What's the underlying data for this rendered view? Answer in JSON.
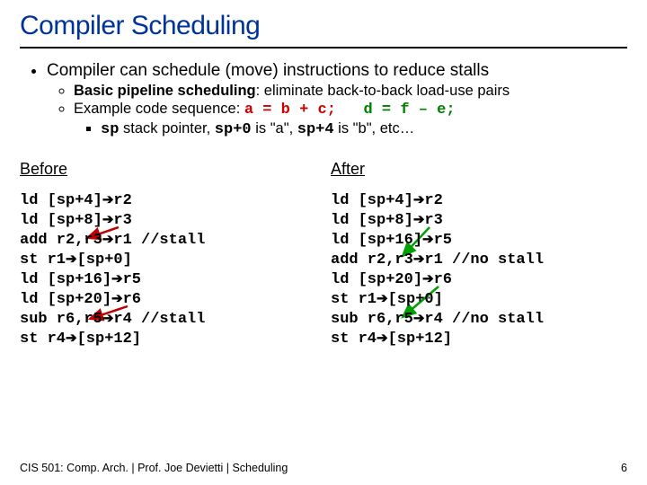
{
  "title": "Compiler Scheduling",
  "b1": "Compiler can schedule (move) instructions to reduce stalls",
  "s1a": "Basic pipeline scheduling",
  "s1b": ": eliminate back-to-back load-use pairs",
  "s2a": "Example code sequence: ",
  "s2c1": "a = b + c;",
  "s2gap": "   ",
  "s2c2": "d = f – e;",
  "ss_a": " stack pointer, ",
  "ss_sp": "sp",
  "ss_b": " is \"a\", ",
  "ss_sp0": "sp+0",
  "ss_c": " is \"b\", etc…",
  "ss_sp4": "sp+4",
  "before": "Before",
  "after": "After",
  "bc": {
    "l1a": "ld [sp+4]",
    "l1b": "r2",
    "l2a": "ld [sp+8]",
    "l2b": "r3",
    "l3a": "add r2,r3",
    "l3b": "r1 //stall",
    "l4a": "st r1",
    "l4b": "[sp+0]",
    "l5a": "ld [sp+16]",
    "l5b": "r5",
    "l6a": "ld [sp+20]",
    "l6b": "r6",
    "l7a": "sub r6,r5",
    "l7b": "r4 //stall",
    "l8a": "st r4",
    "l8b": "[sp+12]"
  },
  "ac": {
    "l1a": "ld [sp+4]",
    "l1b": "r2",
    "l2a": "ld [sp+8]",
    "l2b": "r3",
    "l3a": "ld [sp+16]",
    "l3b": "r5",
    "l4a": "add r2,r3",
    "l4b": "r1 //no stall",
    "l5a": "ld [sp+20]",
    "l5b": "r6",
    "l6a": "st r1",
    "l6b": "[sp+0]",
    "l7a": "sub r6,r5",
    "l7b": "r4 //no stall",
    "l8a": "st r4",
    "l8b": "[sp+12]"
  },
  "arrow": "➔",
  "footer_left": "CIS 501: Comp. Arch. | Prof. Joe Devietti | Scheduling",
  "footer_right": "6"
}
